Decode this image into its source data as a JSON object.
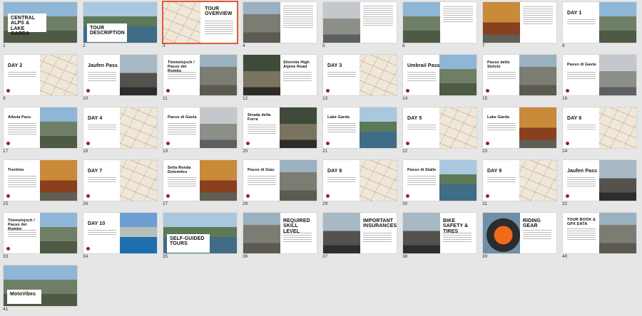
{
  "slides": [
    {
      "n": "1",
      "title": "CENTRAL ALPS & LAKE GARDA",
      "kind": "cover"
    },
    {
      "n": "2",
      "title": "TOUR DESCRIPTION",
      "kind": "panel"
    },
    {
      "n": "3",
      "title": "TOUR OVERVIEW",
      "kind": "overview",
      "selected": true
    },
    {
      "n": "4",
      "title": "",
      "kind": "text-left-pic"
    },
    {
      "n": "5",
      "title": "",
      "kind": "text-left-pic"
    },
    {
      "n": "6",
      "title": "",
      "kind": "text-left-pic"
    },
    {
      "n": "7",
      "title": "",
      "kind": "text-left-pic"
    },
    {
      "n": "8",
      "title": "DAY 1",
      "kind": "map"
    },
    {
      "n": "9",
      "title": "DAY 2",
      "kind": "map"
    },
    {
      "n": "10",
      "title": "Jaufen Pass",
      "kind": "pic"
    },
    {
      "n": "11",
      "title": "Timmelsjoch / Passo del Rombo",
      "kind": "pic"
    },
    {
      "n": "12",
      "title": "Silvretta High Alpine Road",
      "kind": "pic"
    },
    {
      "n": "13",
      "title": "DAY 3",
      "kind": "map"
    },
    {
      "n": "14",
      "title": "Umbrail Pass",
      "kind": "pic"
    },
    {
      "n": "15",
      "title": "Passo dello Stelvio",
      "kind": "pic"
    },
    {
      "n": "16",
      "title": "Passo di Gavia",
      "kind": "pic"
    },
    {
      "n": "17",
      "title": "Albula Pass",
      "kind": "pic"
    },
    {
      "n": "18",
      "title": "DAY 4",
      "kind": "map"
    },
    {
      "n": "19",
      "title": "Passo di Gavia",
      "kind": "pic"
    },
    {
      "n": "20",
      "title": "Strada della Forra",
      "kind": "pic"
    },
    {
      "n": "21",
      "title": "Lake Garda",
      "kind": "pic"
    },
    {
      "n": "22",
      "title": "DAY 5",
      "kind": "map"
    },
    {
      "n": "23",
      "title": "Lake Garda",
      "kind": "pic"
    },
    {
      "n": "24",
      "title": "DAY 6",
      "kind": "map"
    },
    {
      "n": "25",
      "title": "Trentino",
      "kind": "pic"
    },
    {
      "n": "26",
      "title": "DAY 7",
      "kind": "map"
    },
    {
      "n": "27",
      "title": "Sella Ronda Dolomites",
      "kind": "pic"
    },
    {
      "n": "28",
      "title": "Passo di Giau",
      "kind": "pic"
    },
    {
      "n": "29",
      "title": "DAY 8",
      "kind": "map"
    },
    {
      "n": "30",
      "title": "Passo di Stalle",
      "kind": "pic"
    },
    {
      "n": "31",
      "title": "DAY 9",
      "kind": "map"
    },
    {
      "n": "32",
      "title": "Jaufen Pass",
      "kind": "pic"
    },
    {
      "n": "33",
      "title": "Timmelsjoch / Passo del Rombo",
      "kind": "pic"
    },
    {
      "n": "34",
      "title": "DAY 10",
      "kind": "map"
    },
    {
      "n": "35",
      "title": "SELF-GUIDED TOURS",
      "kind": "panel"
    },
    {
      "n": "36",
      "title": "REQUIRED SKILL LEVEL",
      "kind": "pic"
    },
    {
      "n": "37",
      "title": "IMPORTANT INSURANCES",
      "kind": "pic"
    },
    {
      "n": "38",
      "title": "BIKE SAFETY & TIRES",
      "kind": "pic"
    },
    {
      "n": "39",
      "title": "RIDING GEAR",
      "kind": "pic"
    },
    {
      "n": "40",
      "title": "TOUR BOOK & GPX DATA",
      "kind": "pic"
    },
    {
      "n": "41",
      "title": "MotoVibes",
      "kind": "cover-end"
    }
  ]
}
